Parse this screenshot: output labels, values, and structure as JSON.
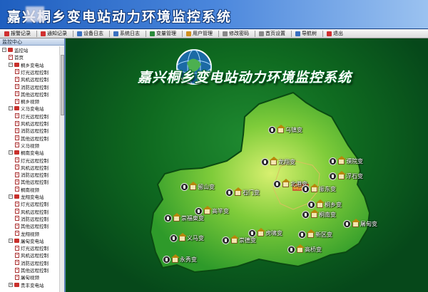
{
  "app": {
    "title": "嘉兴桐乡变电站动力环境监控系统"
  },
  "toolbar": [
    {
      "label": "报警记录",
      "icon": "alarm-record-icon",
      "color": "#d03030"
    },
    {
      "label": "通知记录",
      "icon": "notice-record-icon",
      "color": "#d03030"
    },
    {
      "label": "设备日志",
      "icon": "device-log-icon",
      "color": "#3a70c0"
    },
    {
      "label": "系统日志",
      "icon": "system-log-icon",
      "color": "#3a70c0"
    },
    {
      "label": "变量管理",
      "icon": "variable-manage-icon",
      "color": "#2a8a3a"
    },
    {
      "label": "用户管理",
      "icon": "user-manage-icon",
      "color": "#d09020"
    },
    {
      "label": "修改密码",
      "icon": "change-password-icon",
      "color": "#888888"
    },
    {
      "label": "首页设置",
      "icon": "home-settings-icon",
      "color": "#888888"
    },
    {
      "label": "导航树",
      "icon": "nav-tree-icon",
      "color": "#3a70c0"
    },
    {
      "label": "退出",
      "icon": "exit-icon",
      "color": "#d03030"
    }
  ],
  "sidebar": {
    "title": "监控中心",
    "tree": [
      {
        "label": "监控站",
        "level": 0,
        "type": "folder",
        "expander": "−"
      },
      {
        "label": "首页",
        "level": 1,
        "type": "doc"
      },
      {
        "label": "桐乡变电站",
        "level": 1,
        "type": "folder",
        "expander": "−"
      },
      {
        "label": "灯光远程控制",
        "level": 2,
        "type": "doc"
      },
      {
        "label": "风机远程控制",
        "level": 2,
        "type": "doc"
      },
      {
        "label": "消防远程控制",
        "level": 2,
        "type": "doc"
      },
      {
        "label": "其他远程控制",
        "level": 2,
        "type": "doc"
      },
      {
        "label": "桐乡视频",
        "level": 2,
        "type": "doc"
      },
      {
        "label": "义马变电站",
        "level": 1,
        "type": "folder",
        "expander": "−"
      },
      {
        "label": "灯光远程控制",
        "level": 2,
        "type": "doc"
      },
      {
        "label": "风机远程控制",
        "level": 2,
        "type": "doc"
      },
      {
        "label": "消防远程控制",
        "level": 2,
        "type": "doc"
      },
      {
        "label": "其他远程控制",
        "level": 2,
        "type": "doc"
      },
      {
        "label": "义马视频",
        "level": 2,
        "type": "doc"
      },
      {
        "label": "桐南变电站",
        "level": 1,
        "type": "folder",
        "expander": "−"
      },
      {
        "label": "灯光远程控制",
        "level": 2,
        "type": "doc"
      },
      {
        "label": "风机远程控制",
        "level": 2,
        "type": "doc"
      },
      {
        "label": "消防远程控制",
        "level": 2,
        "type": "doc"
      },
      {
        "label": "其他远程控制",
        "level": 2,
        "type": "doc"
      },
      {
        "label": "桐南视频",
        "level": 2,
        "type": "doc"
      },
      {
        "label": "龙翔变电站",
        "level": 1,
        "type": "folder",
        "expander": "−"
      },
      {
        "label": "灯光远程控制",
        "level": 2,
        "type": "doc"
      },
      {
        "label": "风机远程控制",
        "level": 2,
        "type": "doc"
      },
      {
        "label": "消防远程控制",
        "level": 2,
        "type": "doc"
      },
      {
        "label": "其他远程控制",
        "level": 2,
        "type": "doc"
      },
      {
        "label": "龙翔视频",
        "level": 2,
        "type": "doc"
      },
      {
        "label": "屠甸变电站",
        "level": 1,
        "type": "folder",
        "expander": "−"
      },
      {
        "label": "灯光远程控制",
        "level": 2,
        "type": "doc"
      },
      {
        "label": "风机远程控制",
        "level": 2,
        "type": "doc"
      },
      {
        "label": "消防远程控制",
        "level": 2,
        "type": "doc"
      },
      {
        "label": "其他远程控制",
        "level": 2,
        "type": "doc"
      },
      {
        "label": "屠甸视频",
        "level": 2,
        "type": "doc"
      },
      {
        "label": "贵丰变电站",
        "level": 1,
        "type": "folder",
        "expander": "+"
      }
    ]
  },
  "banner": {
    "title": "嘉兴桐乡变电站动力环境监控系统"
  },
  "map": {
    "highlight_label": "桐乡市",
    "stations": [
      {
        "name": "乌镇变"
      },
      {
        "name": "濮院变"
      },
      {
        "name": "龙翔变"
      },
      {
        "name": "浮石变"
      },
      {
        "name": "北港变"
      },
      {
        "name": "振东变"
      },
      {
        "name": "石门变"
      },
      {
        "name": "桐乡变"
      },
      {
        "name": "留山变"
      },
      {
        "name": "桐南变"
      },
      {
        "name": "高竿变"
      },
      {
        "name": "屠甸变"
      },
      {
        "name": "崇福東变"
      },
      {
        "name": "虎啸变"
      },
      {
        "name": "新区变"
      },
      {
        "name": "义马变"
      },
      {
        "name": "崇德变"
      },
      {
        "name": "高桥变"
      },
      {
        "name": "永秀变"
      }
    ]
  }
}
